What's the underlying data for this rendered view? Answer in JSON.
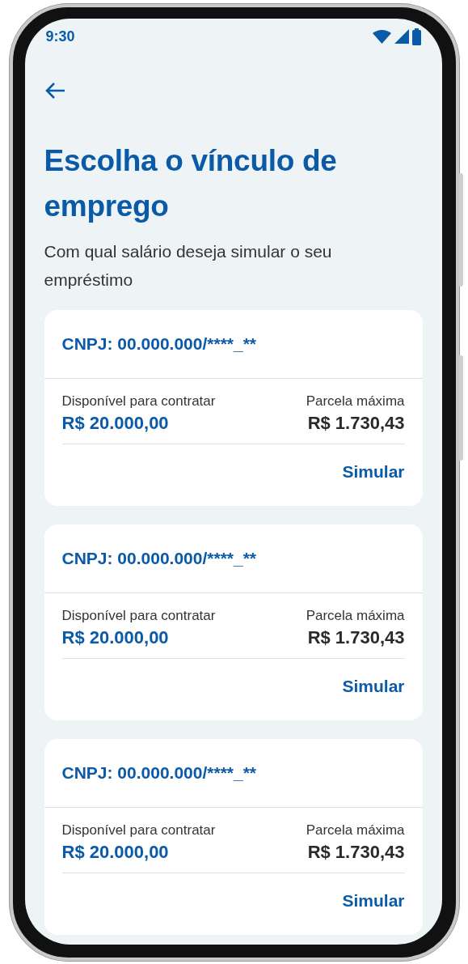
{
  "status_bar": {
    "time": "9:30"
  },
  "header": {
    "title": "Escolha o vínculo de emprego",
    "subtitle": "Com qual salário deseja simular o seu empréstimo"
  },
  "employments": [
    {
      "cnpj": "CNPJ: 00.000.000/****_**",
      "available_label": "Disponível para contratar",
      "available_value": "R$ 20.000,00",
      "installment_label": "Parcela máxima",
      "installment_value": "R$ 1.730,43",
      "action": "Simular"
    },
    {
      "cnpj": "CNPJ: 00.000.000/****_**",
      "available_label": "Disponível para contratar",
      "available_value": "R$ 20.000,00",
      "installment_label": "Parcela máxima",
      "installment_value": "R$ 1.730,43",
      "action": "Simular"
    },
    {
      "cnpj": "CNPJ: 00.000.000/****_**",
      "available_label": "Disponível para contratar",
      "available_value": "R$ 20.000,00",
      "installment_label": "Parcela máxima",
      "installment_value": "R$ 1.730,43",
      "action": "Simular"
    }
  ]
}
